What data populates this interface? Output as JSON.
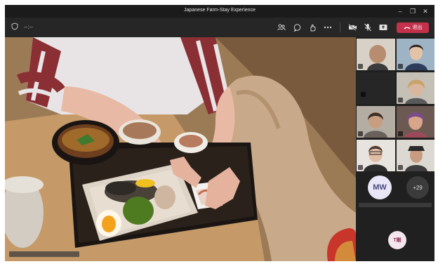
{
  "window": {
    "title": "Japanese Farm-Stay Experience",
    "controls": [
      "–",
      "❐",
      "✕"
    ]
  },
  "toolbar": {
    "left_text": "--:--",
    "leave_label": "退出",
    "leave_color": "#c4314b"
  },
  "participants": {
    "avatar_initials": "MW",
    "overflow_count": "+29",
    "presenter_initials": "T剛"
  }
}
